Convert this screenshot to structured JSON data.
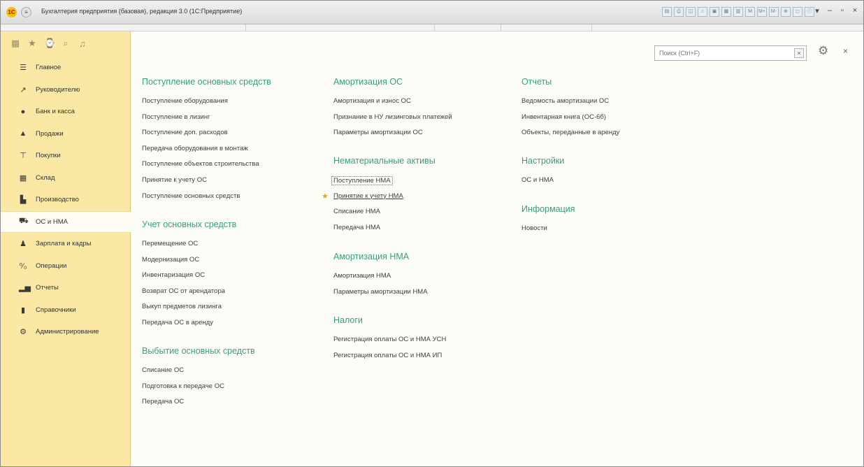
{
  "window": {
    "title": "Бухгалтерия предприятия (базовая), редакция 3.0 (1С:Предприятие)",
    "logo_text": "1С",
    "controls": [
      "▾",
      "–",
      "▫",
      "×"
    ]
  },
  "toolbar_icons": [
    "▤",
    "⎙",
    "◫",
    "⌂",
    "▣",
    "▦",
    "▥",
    "M",
    "M+",
    "M-",
    "⊕",
    "◻",
    "ⓘ"
  ],
  "sidebar": {
    "tools": [
      "▦",
      "★",
      "⌚",
      "⌕",
      "♫"
    ],
    "items": [
      {
        "label": "Главное",
        "icon": "list-icon",
        "glyph": "☰"
      },
      {
        "label": "Руководителю",
        "icon": "trend-icon",
        "glyph": "↗"
      },
      {
        "label": "Банк и касса",
        "icon": "coin-icon",
        "glyph": "●"
      },
      {
        "label": "Продажи",
        "icon": "bag-icon",
        "glyph": "▲"
      },
      {
        "label": "Покупки",
        "icon": "cart-icon",
        "glyph": "⊤"
      },
      {
        "label": "Склад",
        "icon": "warehouse-icon",
        "glyph": "▦"
      },
      {
        "label": "Производство",
        "icon": "factory-icon",
        "glyph": "▙"
      },
      {
        "label": "ОС и НМА",
        "icon": "truck-icon",
        "glyph": "⛟"
      },
      {
        "label": "Зарплата и кадры",
        "icon": "person-icon",
        "glyph": "♟"
      },
      {
        "label": "Операции",
        "icon": "operations-icon",
        "glyph": "⁰⁄₀"
      },
      {
        "label": "Отчеты",
        "icon": "bar-chart-icon",
        "glyph": "▂▅"
      },
      {
        "label": "Справочники",
        "icon": "book-icon",
        "glyph": "▮"
      },
      {
        "label": "Администрирование",
        "icon": "gear-icon",
        "glyph": "⚙"
      }
    ],
    "active_index": 7
  },
  "search": {
    "placeholder": "Поиск (Ctrl+F)",
    "clear": "×"
  },
  "settings_glyph": "⚙",
  "close_glyph": "×",
  "sections": {
    "col1": [
      {
        "title": "Поступление основных средств",
        "items": [
          "Поступление оборудования",
          "Поступление в лизинг",
          "Поступление доп. расходов",
          "Передача оборудования в монтаж",
          "Поступление объектов строительства",
          "Принятие к учету ОС",
          "Поступление основных средств"
        ]
      },
      {
        "title": "Учет основных средств",
        "items": [
          "Перемещение ОС",
          "Модернизация ОС",
          "Инвентаризация ОС",
          "Возврат ОС от арендатора",
          "Выкуп предметов лизинга",
          "Передача ОС в аренду"
        ]
      },
      {
        "title": "Выбытие основных средств",
        "items": [
          "Списание ОС",
          "Подготовка к передаче ОС",
          "Передача ОС"
        ]
      }
    ],
    "col2": [
      {
        "title": "Амортизация ОС",
        "items": [
          "Амортизация и износ ОС",
          "Признание в НУ лизинговых платежей",
          "Параметры амортизации ОС"
        ]
      },
      {
        "title": "Нематериальные активы",
        "items": [
          "Поступление НМА",
          "Принятие к учету НМА",
          "Списание НМА",
          "Передача НМА"
        ]
      },
      {
        "title": "Амортизация НМА",
        "items": [
          "Амортизация НМА",
          "Параметры амортизации НМА"
        ]
      },
      {
        "title": "Налоги",
        "items": [
          "Регистрация оплаты ОС и НМА УСН",
          "Регистрация оплаты ОС и НМА ИП"
        ]
      }
    ],
    "col3": [
      {
        "title": "Отчеты",
        "items": [
          "Ведомость амортизации ОС",
          "Инвентарная книга (ОС-6б)",
          "Объекты, переданные в аренду"
        ]
      },
      {
        "title": "Настройки",
        "items": [
          "ОС и НМА"
        ]
      },
      {
        "title": "Информация",
        "items": [
          "Новости"
        ]
      }
    ]
  },
  "colors": {
    "sidebar_bg": "#fae8a4",
    "section_title": "#3a9e74",
    "star": "#f0a020"
  }
}
